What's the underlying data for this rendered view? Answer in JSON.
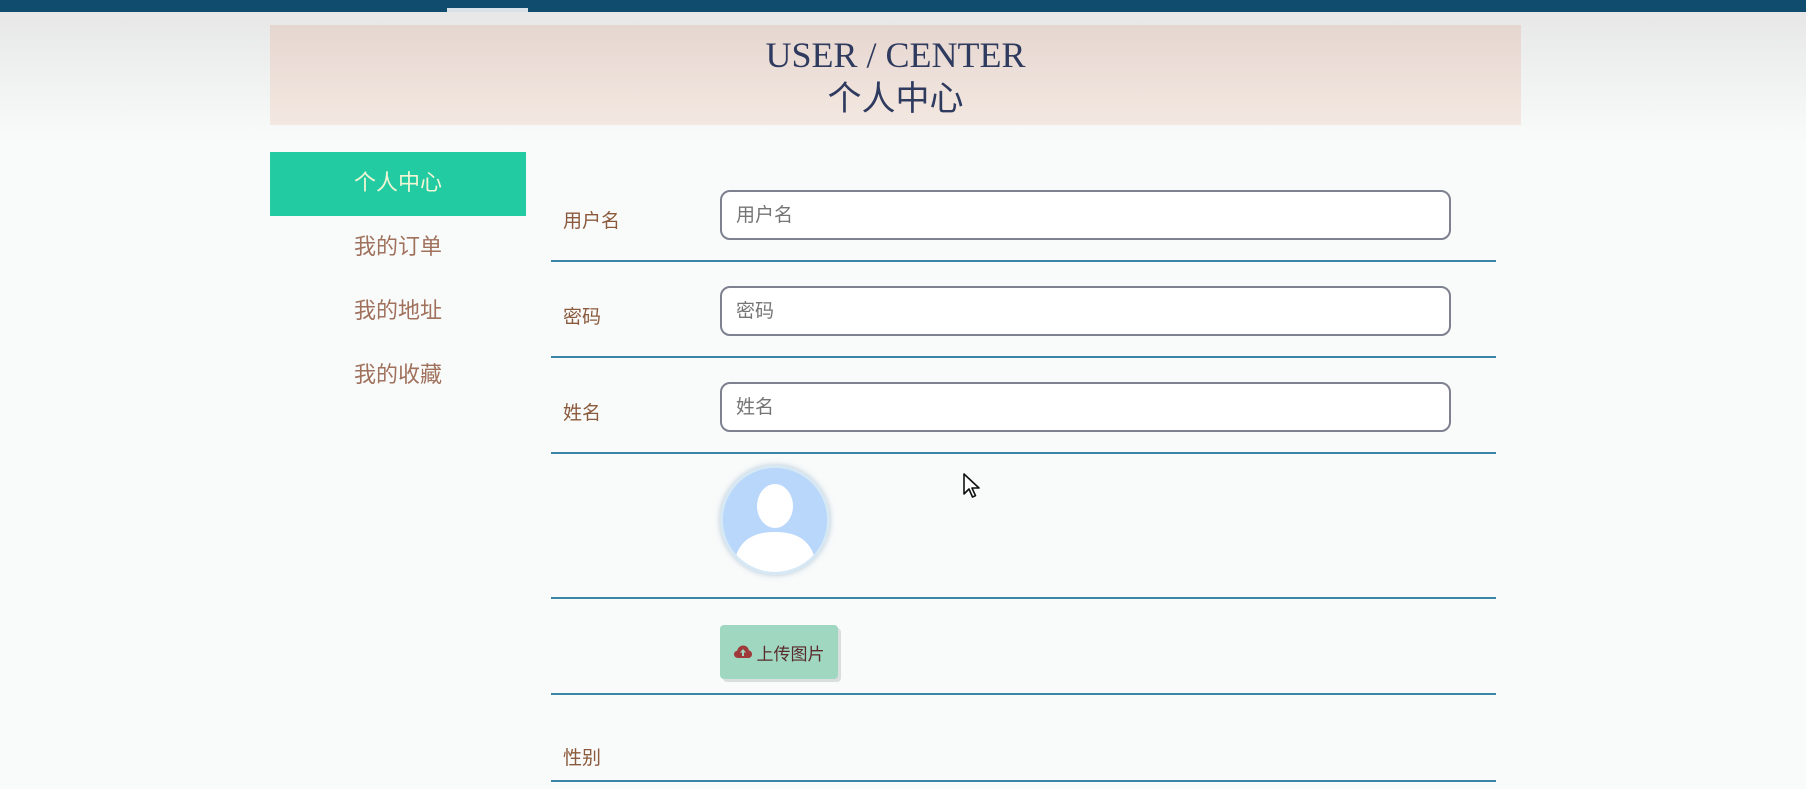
{
  "banner": {
    "title_en": "USER / CENTER",
    "title_zh": "个人中心"
  },
  "sidebar": {
    "items": [
      {
        "label": "个人中心",
        "active": true
      },
      {
        "label": "我的订单",
        "active": false
      },
      {
        "label": "我的地址",
        "active": false
      },
      {
        "label": "我的收藏",
        "active": false
      }
    ]
  },
  "form": {
    "username": {
      "label": "用户名",
      "placeholder": "用户名",
      "value": ""
    },
    "password": {
      "label": "密码",
      "placeholder": "密码",
      "value": ""
    },
    "name": {
      "label": "姓名",
      "placeholder": "姓名",
      "value": ""
    },
    "upload_button": {
      "label": "上传图片",
      "icon": "cloud-upload-icon"
    },
    "gender": {
      "label": "性别"
    }
  },
  "colors": {
    "topbar": "#0f4c6e",
    "sidebar_active": "#23cba3",
    "divider": "#3b86a6",
    "upload_button": "#9fd7c1"
  }
}
